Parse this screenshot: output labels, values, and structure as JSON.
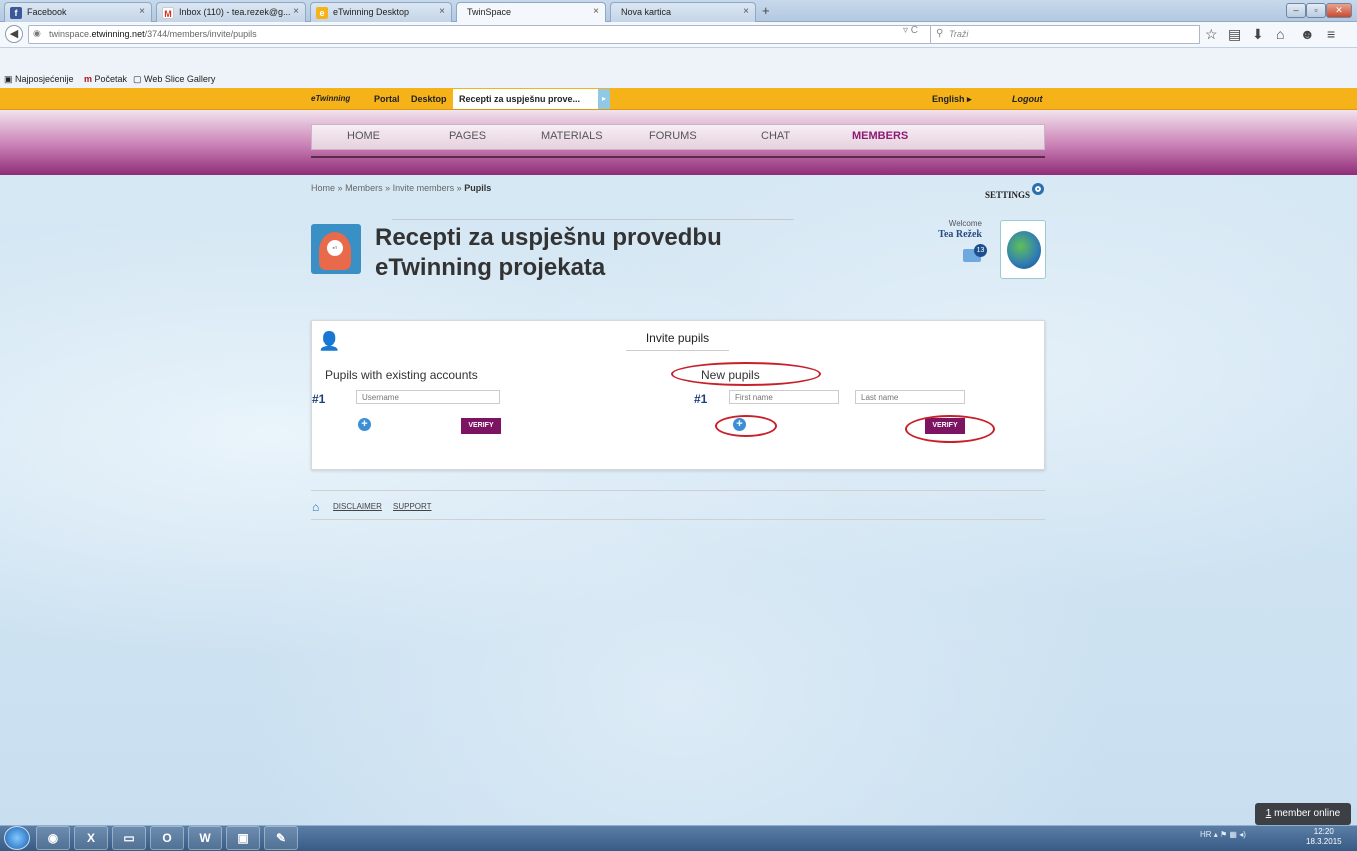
{
  "browser": {
    "tabs": [
      {
        "label": "Facebook",
        "icon": "facebook-icon"
      },
      {
        "label": "Inbox (110) - tea.rezek@g...",
        "icon": "gmail-icon"
      },
      {
        "label": "eTwinning Desktop",
        "icon": "etwinning-icon"
      },
      {
        "label": "TwinSpace",
        "icon": ""
      },
      {
        "label": "Nova kartica",
        "icon": ""
      }
    ],
    "url_prefix": "twinspace.",
    "url_domain": "etwinning.net",
    "url_path": "/3744/members/invite/pupils",
    "search_placeholder": "Traži",
    "bookmarks": [
      "Najposjećenije",
      "Početak",
      "Web Slice Gallery"
    ]
  },
  "etwinning_bar": {
    "logo": "eTwinning",
    "portal": "Portal",
    "desktop": "Desktop",
    "current": "Recepti za uspješnu prove...",
    "language": "English ▸",
    "logout": "Logout"
  },
  "menu": {
    "items": [
      "HOME",
      "PAGES",
      "MATERIALS",
      "FORUMS",
      "CHAT",
      "MEMBERS"
    ],
    "active": "MEMBERS"
  },
  "breadcrumb": {
    "home": "Home",
    "members": "Members",
    "invite": "Invite members",
    "current": "Pupils",
    "sep": "»"
  },
  "settings_label": "SETTINGS",
  "project": {
    "title_line1": "Recepti za uspješnu provedbu",
    "title_line2": "eTwinning projekata"
  },
  "user": {
    "welcome": "Welcome",
    "name": "Tea Režek",
    "messages": "13"
  },
  "invite": {
    "title": "Invite pupils",
    "existing_heading": "Pupils with existing accounts",
    "new_heading": "New pupils",
    "row_number": "#1",
    "username_placeholder": "Username",
    "firstname_placeholder": "First name",
    "lastname_placeholder": "Last name",
    "verify_label": "VERIFY"
  },
  "footer": {
    "disclaimer": "DISCLAIMER",
    "support": "SUPPORT"
  },
  "online": {
    "count": "1",
    "label": " member online"
  },
  "taskbar": {
    "language": "HR",
    "time": "12:20",
    "date": "18.3.2015"
  },
  "colors": {
    "accent_purple": "#7c1463",
    "etwinning_yellow": "#f5b219",
    "annotation_red": "#c8202a"
  }
}
